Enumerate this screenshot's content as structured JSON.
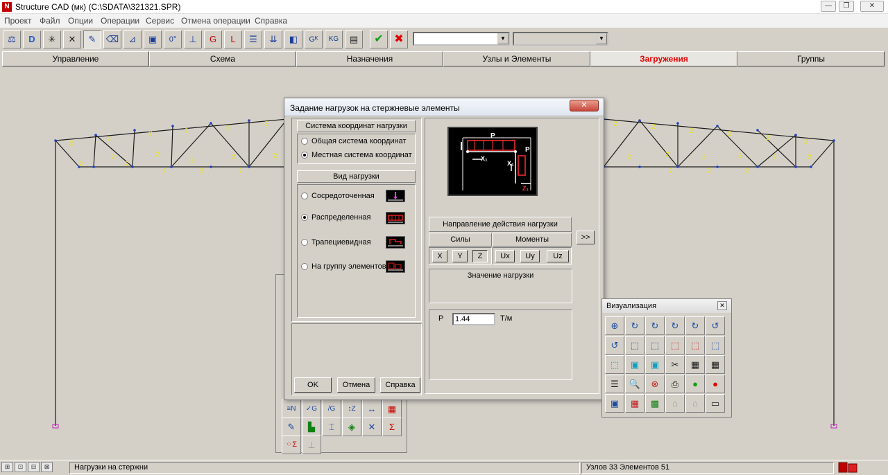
{
  "window": {
    "title": "Structure CAD (мк) (C:\\SDATA\\321321.SPR)",
    "app_icon": "N",
    "controls": [
      "—",
      "❐",
      "✕"
    ]
  },
  "menu": [
    "Проект",
    "Файл",
    "Опции",
    "Операции",
    "Сервис",
    "Отмена операции",
    "Справка"
  ],
  "toolbar": {
    "buttons": [
      {
        "icon": "scale-icon",
        "glyph": "⚖"
      },
      {
        "icon": "d-icon",
        "glyph": "D"
      },
      {
        "icon": "node-cross-icon",
        "glyph": "✳"
      },
      {
        "icon": "node-add-icon",
        "glyph": "✕"
      },
      {
        "icon": "draw-line-icon",
        "glyph": "✎"
      },
      {
        "icon": "eraser-icon",
        "glyph": "⌫"
      },
      {
        "icon": "axes-icon",
        "glyph": "⊿"
      },
      {
        "icon": "cube-icon",
        "glyph": "▣"
      },
      {
        "icon": "numbering-icon",
        "glyph": "0°"
      },
      {
        "icon": "support-icon",
        "glyph": "⊥"
      },
      {
        "icon": "g-icon",
        "glyph": "G"
      },
      {
        "icon": "l-icon",
        "glyph": "L"
      },
      {
        "icon": "beam-icon",
        "glyph": "☰"
      },
      {
        "icon": "loads-icon",
        "glyph": "⇊"
      },
      {
        "icon": "element-icon",
        "glyph": "◧"
      },
      {
        "icon": "gk-icon",
        "glyph": "Gᴷ"
      },
      {
        "icon": "kg-icon",
        "glyph": "KG"
      },
      {
        "icon": "report-icon",
        "glyph": "▤"
      },
      {
        "icon": "confirm-icon",
        "glyph": "✔"
      },
      {
        "icon": "cancel-icon",
        "glyph": "✖"
      }
    ],
    "combo1_value": "",
    "combo2_value": ""
  },
  "tabs": [
    "Управление",
    "Схема",
    "Назначения",
    "Узлы и Элементы",
    "Загружения",
    "Группы"
  ],
  "active_tab": "Загружения",
  "dialog": {
    "title": "Задание нагрузок на стержневые элементы",
    "close": "✕",
    "coord_system_header": "Система координат нагрузки",
    "coord_options": [
      "Общая система координат",
      "Местная  система координат"
    ],
    "coord_selected": 1,
    "load_type_header": "Вид нагрузки",
    "load_types": [
      "Сосредоточенная",
      "Распределенная",
      "Трапециевидная",
      "На группу элементов"
    ],
    "load_type_selected": 1,
    "diagram": {
      "p": "P",
      "x1": "X₁",
      "z1": "Z₁"
    },
    "direction_header": "Направление действия нагрузки",
    "forces_header": "Силы",
    "moments_header": "Моменты",
    "force_buttons": [
      "X",
      "Y",
      "Z"
    ],
    "moment_buttons": [
      "Ux",
      "Uy",
      "Uz"
    ],
    "more_button": ">>",
    "value_header": "Значение нагрузки",
    "p_label": "P",
    "p_value": "1.44",
    "unit": "Т/м",
    "ok": "OK",
    "cancel": "Отмена",
    "help": "Справка"
  },
  "visualization": {
    "title": "Визуализация",
    "close": "✕",
    "icons": [
      "⊕",
      "↻",
      "↻",
      "↻",
      "↻",
      "↺",
      "↺",
      "⬚",
      "⬚",
      "⬚",
      "⬚",
      "⬚",
      "⬚",
      "▣",
      "▣",
      "✂",
      "▦",
      "▦",
      "☰",
      "🔍",
      "⊗",
      "⎙",
      "●",
      "●",
      "▣",
      "▦",
      "▩",
      "⌂",
      "⌂",
      "▭"
    ]
  },
  "status": {
    "left_icons": [
      "⊞",
      "⊡",
      "⊟",
      "⊠"
    ],
    "message": "Нагрузки на стержни",
    "counts": "Узлов 33 Элементов 51"
  },
  "colors": {
    "accent_red": "#e00000",
    "truss_line": "#1a1a1a",
    "node": "#2040c0",
    "load_label": "#e8e020"
  }
}
